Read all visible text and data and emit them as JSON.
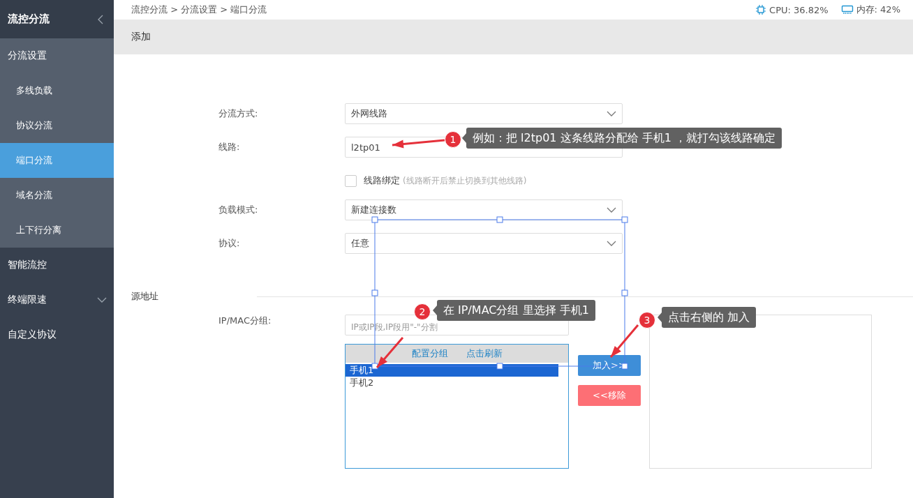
{
  "sidebar": {
    "title": "流控分流",
    "items": [
      {
        "label": "分流设置",
        "selected": false,
        "expanded": true,
        "children": [
          {
            "label": "多线负载",
            "selected": false
          },
          {
            "label": "协议分流",
            "selected": false
          },
          {
            "label": "端口分流",
            "selected": true
          },
          {
            "label": "域名分流",
            "selected": false
          },
          {
            "label": "上下行分离",
            "selected": false
          }
        ]
      },
      {
        "label": "智能流控",
        "selected": false
      },
      {
        "label": "终端限速",
        "selected": false,
        "expanded": false
      },
      {
        "label": "自定义协议",
        "selected": false
      }
    ]
  },
  "top_bar": {
    "breadcrumb": "流控分流 > 分流设置 > 端口分流",
    "cpu": "CPU: 36.82%",
    "memory": "内存: 42%"
  },
  "panel_title": "添加",
  "form": [
    {
      "kind": "select",
      "label": "分流方式:",
      "value": "外网线路"
    },
    {
      "kind": "input",
      "label": "线路:",
      "value": "l2tp01"
    },
    {
      "kind": "checkbox",
      "label": "线路绑定",
      "hint": "(线路断开后禁止切换到其他线路)",
      "checked": false
    },
    {
      "kind": "select",
      "label": "负载模式:",
      "value": "新建连接数"
    },
    {
      "kind": "select",
      "label": "协议:",
      "value": "任意"
    }
  ],
  "source": {
    "title": "源地址",
    "label": "IP/MAC分组:",
    "placeholder": "IP或IP段,IP段用\"-\"分割",
    "list_links": [
      "配置分组",
      "点击刷新"
    ],
    "groups": [
      {
        "label": "手机1",
        "selected": true
      },
      {
        "label": "手机2",
        "selected": false
      }
    ],
    "add_button": "加入>>",
    "remove_button": "<<移除"
  },
  "annotations": [
    {
      "number": "1",
      "text": "例如：把 l2tp01 这条线路分配给 手机1 ，就打勾该线路确定"
    },
    {
      "number": "2",
      "text": "在 IP/MAC分组 里选择 手机1"
    },
    {
      "number": "3",
      "text": "点击右侧的 加入"
    }
  ]
}
